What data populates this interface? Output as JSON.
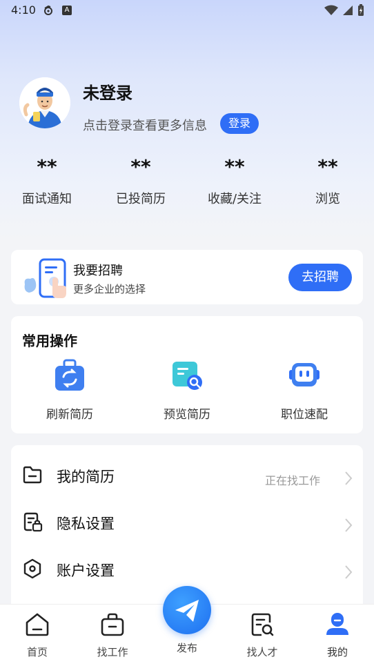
{
  "status_bar": {
    "time": "4:10",
    "a_icon_label": "A"
  },
  "profile": {
    "name": "未登录",
    "hint": "点击登录查看更多信息",
    "login_label": "登录"
  },
  "stats": [
    {
      "value": "**",
      "label": "面试通知"
    },
    {
      "value": "**",
      "label": "已投简历"
    },
    {
      "value": "**",
      "label": "收藏/关注"
    },
    {
      "value": "**",
      "label": "浏览"
    }
  ],
  "recruit": {
    "title": "我要招聘",
    "subtitle": "更多企业的选择",
    "button_label": "去招聘"
  },
  "common_ops": {
    "title": "常用操作",
    "items": [
      {
        "label": "刷新简历",
        "icon": "refresh-bag-icon"
      },
      {
        "label": "预览简历",
        "icon": "preview-resume-icon"
      },
      {
        "label": "职位速配",
        "icon": "robot-icon"
      }
    ]
  },
  "menu": [
    {
      "label": "我的简历",
      "value": "正在找工作",
      "icon": "folder-icon"
    },
    {
      "label": "隐私设置",
      "value": "",
      "icon": "privacy-lock-icon"
    },
    {
      "label": "账户设置",
      "value": "",
      "icon": "hexagon-settings-icon"
    }
  ],
  "bottom_nav": {
    "items": [
      {
        "label": "首页",
        "icon": "home-icon"
      },
      {
        "label": "找工作",
        "icon": "briefcase-icon"
      },
      {
        "label": "发布",
        "icon": "paper-plane-icon"
      },
      {
        "label": "找人才",
        "icon": "search-resume-icon"
      },
      {
        "label": "我的",
        "icon": "profile-icon"
      }
    ],
    "active_index": 4
  },
  "colors": {
    "accent": "#2f6ef6",
    "background": "#f3f4f7"
  }
}
